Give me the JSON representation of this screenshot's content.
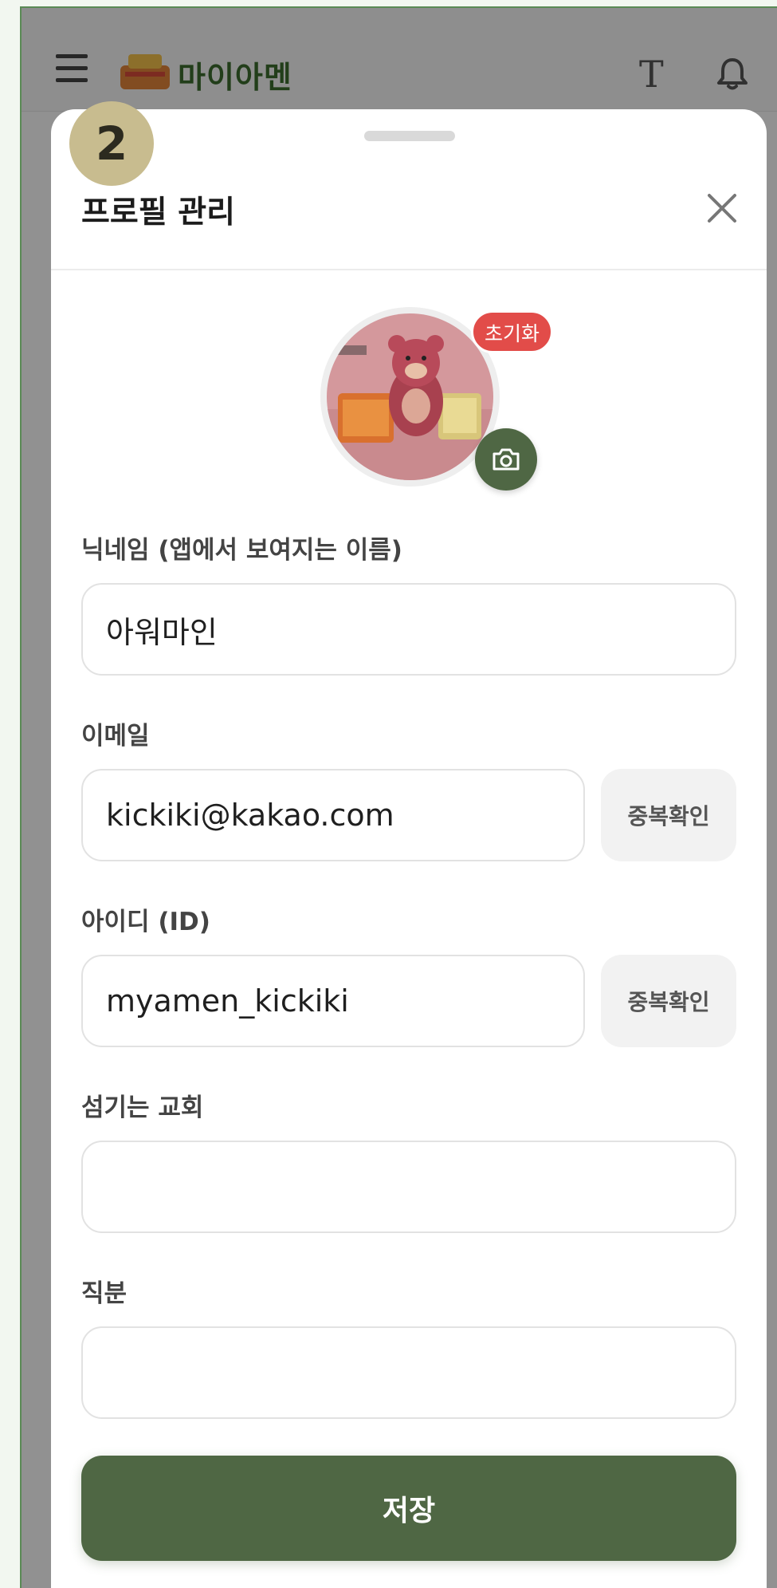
{
  "app": {
    "brand_name": "마이아멘"
  },
  "sheet": {
    "title": "프로필 관리"
  },
  "avatar": {
    "reset_label": "초기화"
  },
  "form": {
    "nickname_label": "닉네임 (앱에서 보여지는 이름)",
    "nickname_value": "아워마인",
    "email_label": "이메일",
    "email_value": "kickiki@kakao.com",
    "email_check_label": "중복확인",
    "id_label": "아이디 (ID)",
    "id_value": "myamen_kickiki",
    "id_check_label": "중복확인",
    "church_label": "섬기는 교회",
    "church_value": "",
    "position_label": "직분",
    "position_value": ""
  },
  "save_label": "저장",
  "step_badge": "2",
  "colors": {
    "primary": "#4f6744",
    "reset_badge": "#e24c49",
    "step_badge": "#c8bc8f"
  },
  "icons": [
    "menu-icon",
    "logo-icon",
    "text-size-icon",
    "bell-icon",
    "close-icon",
    "camera-icon"
  ]
}
